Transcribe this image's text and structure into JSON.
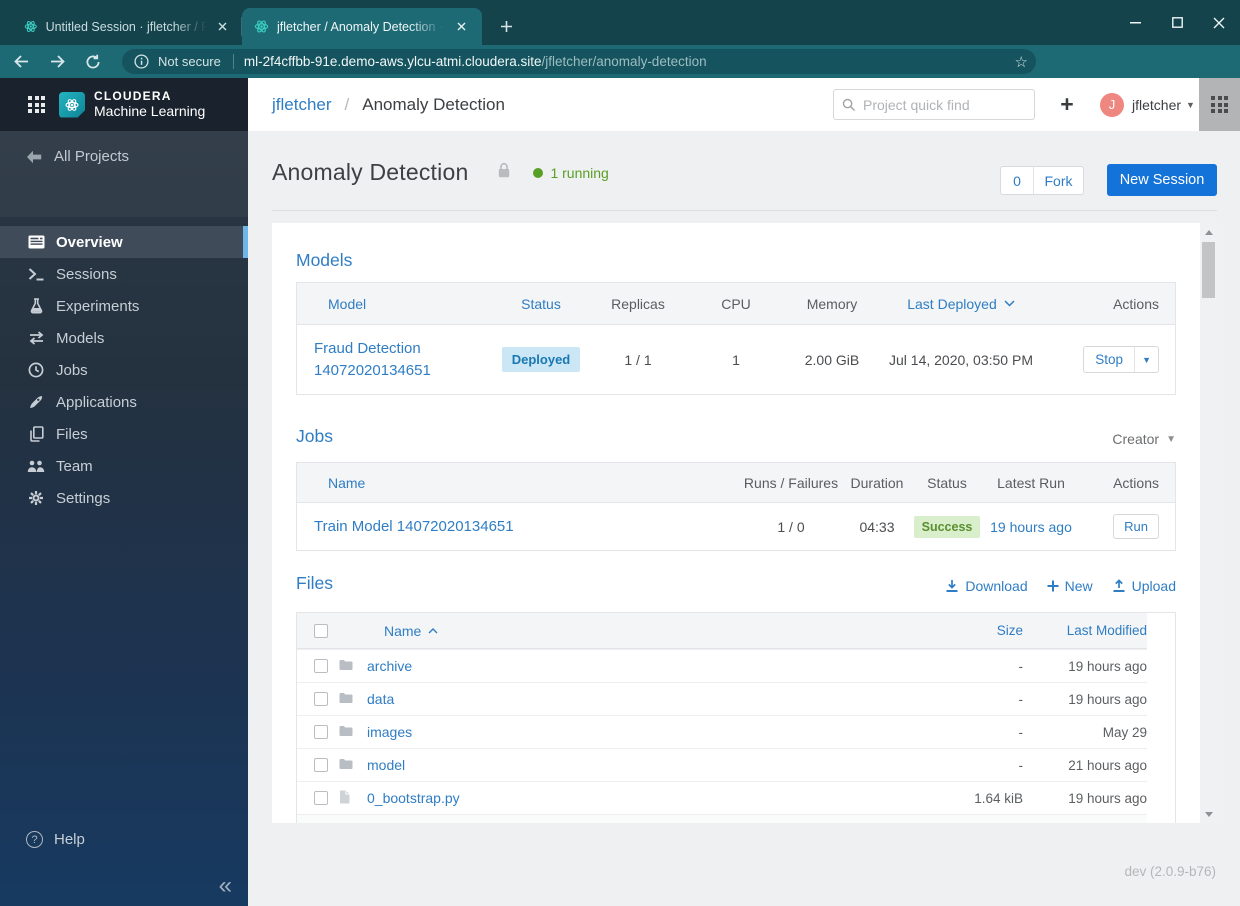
{
  "browser": {
    "tabs": [
      {
        "title": "Untitled Session · jfletcher / Frau",
        "active": false
      },
      {
        "title": "jfletcher / Anomaly Detection · Cl",
        "active": true
      }
    ],
    "url": {
      "security_label": "Not secure",
      "domain": "ml-2f4cffbb-91e.demo-aws.ylcu-atmi.cloudera.site",
      "path": "/jfletcher/anomaly-detection"
    }
  },
  "header": {
    "brand_line1": "CLOUDERA",
    "brand_line2": "Machine Learning",
    "breadcrumb": {
      "user": "jfletcher",
      "separator": "/",
      "project": "Anomaly Detection"
    },
    "search_placeholder": "Project quick find",
    "user": {
      "initial": "J",
      "name": "jfletcher"
    }
  },
  "sidebar": {
    "back_label": "All Projects",
    "items": [
      {
        "label": "Overview",
        "active": true
      },
      {
        "label": "Sessions"
      },
      {
        "label": "Experiments"
      },
      {
        "label": "Models"
      },
      {
        "label": "Jobs"
      },
      {
        "label": "Applications"
      },
      {
        "label": "Files"
      },
      {
        "label": "Team"
      },
      {
        "label": "Settings"
      }
    ],
    "help_label": "Help"
  },
  "project": {
    "title": "Anomaly Detection",
    "running_label": "1 running",
    "fork_count": "0",
    "fork_label": "Fork",
    "new_session_label": "New Session"
  },
  "models": {
    "heading": "Models",
    "columns": {
      "model": "Model",
      "status": "Status",
      "replicas": "Replicas",
      "cpu": "CPU",
      "memory": "Memory",
      "last_deployed": "Last Deployed",
      "actions": "Actions"
    },
    "rows": [
      {
        "name_line1": "Fraud Detection",
        "name_line2": "14072020134651",
        "status": "Deployed",
        "replicas": "1 / 1",
        "cpu": "1",
        "memory": "2.00 GiB",
        "last_deployed": "Jul 14, 2020, 03:50 PM",
        "action": "Stop"
      }
    ]
  },
  "jobs": {
    "heading": "Jobs",
    "filter_label": "Creator",
    "columns": {
      "name": "Name",
      "runs": "Runs / Failures",
      "duration": "Duration",
      "status": "Status",
      "latest_run": "Latest Run",
      "actions": "Actions"
    },
    "rows": [
      {
        "name": "Train Model 14072020134651",
        "runs": "1 / 0",
        "duration": "04:33",
        "status": "Success",
        "latest_run": "19 hours ago",
        "action": "Run"
      }
    ]
  },
  "files": {
    "heading": "Files",
    "actions": {
      "download": "Download",
      "new": "New",
      "upload": "Upload"
    },
    "columns": {
      "name": "Name",
      "size": "Size",
      "modified": "Last Modified"
    },
    "rows": [
      {
        "type": "folder",
        "name": "archive",
        "size": "-",
        "modified": "19 hours ago"
      },
      {
        "type": "folder",
        "name": "data",
        "size": "-",
        "modified": "19 hours ago"
      },
      {
        "type": "folder",
        "name": "images",
        "size": "-",
        "modified": "May 29"
      },
      {
        "type": "folder",
        "name": "model",
        "size": "-",
        "modified": "21 hours ago"
      },
      {
        "type": "file",
        "name": "0_bootstrap.py",
        "size": "1.64 kiB",
        "modified": "19 hours ago"
      }
    ]
  },
  "footer": {
    "version": "dev (2.0.9-b76)"
  },
  "colors": {
    "accent_blue": "#2f7dc4",
    "primary_button": "#1373d9",
    "success_green": "#5a9f25",
    "deployed_badge_bg": "#cbe6f4",
    "deployed_badge_text": "#1878b4",
    "success_badge_bg": "#d9eecb",
    "success_badge_text": "#5a8f2f",
    "browser_frame": "#15434c",
    "browser_toolbar": "#1d6a74",
    "sidebar_top": "#2b3643",
    "sidebar_bottom": "#173a61",
    "brand_teal": "#18a2b0"
  }
}
